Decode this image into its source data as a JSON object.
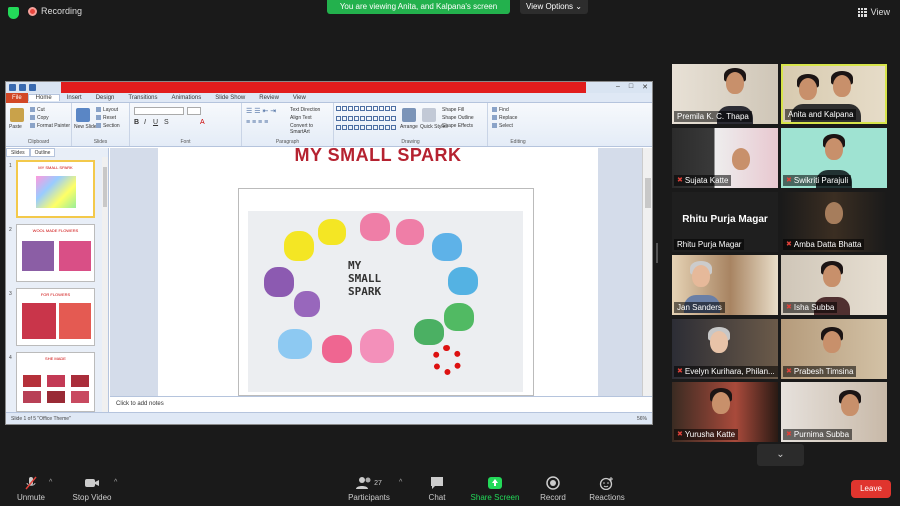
{
  "top": {
    "recording_label": "Recording",
    "viewing_banner": "You are viewing Anita, and Kalpana's screen",
    "view_options_label": "View Options",
    "view_label": "View"
  },
  "ppt": {
    "window_title": "",
    "tabs": [
      "File",
      "Home",
      "Insert",
      "Design",
      "Transitions",
      "Animations",
      "Slide Show",
      "Review",
      "View"
    ],
    "active_tab": "Home",
    "ribbon": {
      "paste": "Paste",
      "cut": "Cut",
      "copy": "Copy",
      "format_painter": "Format Painter",
      "clipboard": "Clipboard",
      "new_slide": "New Slide",
      "layout": "Layout",
      "reset": "Reset",
      "section": "Section",
      "slides": "Slides",
      "font": "Font",
      "paragraph": "Paragraph",
      "text_direction": "Text Direction",
      "align_text": "Align Text",
      "convert_smartart": "Convert to SmartArt",
      "arrange": "Arrange",
      "quick_styles": "Quick Styles",
      "shape_fill": "Shape Fill",
      "shape_outline": "Shape Outline",
      "shape_effects": "Shape Effects",
      "drawing": "Drawing",
      "find": "Find",
      "replace": "Replace",
      "select": "Select",
      "editing": "Editing"
    },
    "panel_tabs": [
      "Slides",
      "Outline"
    ],
    "thumbnails": [
      {
        "num": "1",
        "title": "MY SMALL SPARK"
      },
      {
        "num": "2",
        "title": "WOOL MADE FLOWERS"
      },
      {
        "num": "3",
        "title": "FOR FLOWERS"
      },
      {
        "num": "4",
        "title": "SHE MADE"
      }
    ],
    "slide_title": "MY SMALL SPARK",
    "photo_text": "MY\nSMALL\nSPARK",
    "notes_placeholder": "Click to add notes",
    "status_left": "Slide 1 of 5  \"Office Theme\"",
    "status_zoom": "56%"
  },
  "participants": [
    {
      "name": "Premila K. C. Thapa",
      "muted": false
    },
    {
      "name": "Anita and Kalpana",
      "muted": false
    },
    {
      "name": "Sujata Katte",
      "muted": true
    },
    {
      "name": "Swikriti Parajuli",
      "muted": true
    },
    {
      "name": "Rhitu Purja Magar",
      "muted": false,
      "video_off": true
    },
    {
      "name": "Amba Datta Bhatta",
      "muted": true
    },
    {
      "name": "Jan Sanders",
      "muted": false
    },
    {
      "name": "Isha Subba",
      "muted": true
    },
    {
      "name": "Evelyn Kurihara, Philan...",
      "muted": true
    },
    {
      "name": "Prabesh Timsina",
      "muted": true
    },
    {
      "name": "Yurusha Katte",
      "muted": true
    },
    {
      "name": "Purnima Subba",
      "muted": true
    }
  ],
  "toolbar": {
    "unmute": "Unmute",
    "stop_video": "Stop Video",
    "participants": "Participants",
    "participants_count": "27",
    "chat": "Chat",
    "share_screen": "Share Screen",
    "record": "Record",
    "reactions": "Reactions",
    "leave": "Leave"
  }
}
